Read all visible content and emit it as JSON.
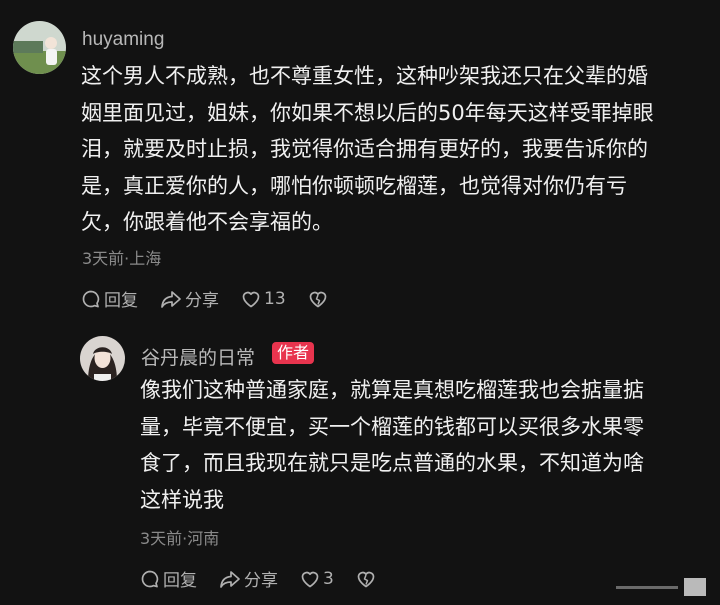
{
  "comments": [
    {
      "username": "huyaming",
      "lines": [
        "这个男人不成熟，也不尊重女性，这种吵架我还只在父辈的婚",
        "姻里面见过，姐妹，你如果不想以后的50年每天这样受罪掉眼",
        "泪，就要及时止损，我觉得你适合拥有更好的，我要告诉你的",
        "是，真正爱你的人，哪怕你顿顿吃榴莲，也觉得对你仍有亏",
        "欠，你跟着他不会享福的。"
      ],
      "meta": "3天前·上海",
      "reply_label": "回复",
      "share_label": "分享",
      "like_count": "13"
    },
    {
      "username": "谷丹晨的日常",
      "badge": "作者",
      "lines": [
        "像我们这种普通家庭，就算是真想吃榴莲我也会掂量掂",
        "量，毕竟不便宜，买一个榴莲的钱都可以买很多水果零",
        "食了，而且我现在就只是吃点普通的水果，不知道为啥",
        "这样说我"
      ],
      "meta": "3天前·河南",
      "reply_label": "回复",
      "share_label": "分享",
      "like_count": "3"
    }
  ],
  "icons": {
    "reply": "reply-icon",
    "share": "share-icon",
    "like": "heart-icon",
    "dislike": "broken-heart-icon"
  },
  "colors": {
    "background": "#121212",
    "badge": "#e8344e",
    "meta": "#8a8a8a"
  }
}
